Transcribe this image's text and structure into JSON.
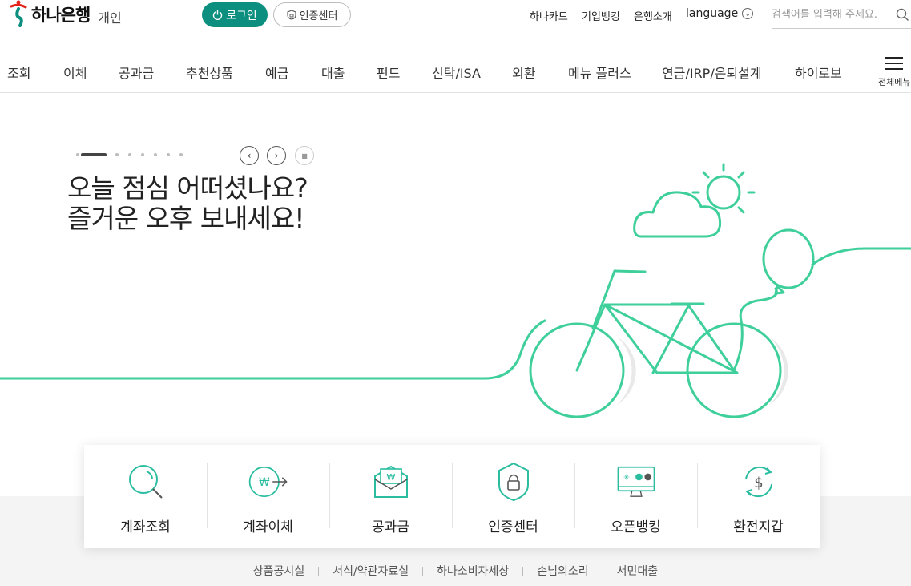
{
  "header": {
    "logo_text": "하나은행",
    "logo_sub": "개인",
    "login_label": "로그인",
    "cert_label": "인증센터",
    "links": [
      "하나카드",
      "기업뱅킹",
      "은행소개"
    ],
    "language_label": "language",
    "search_placeholder": "검색어를 입력해 주세요."
  },
  "nav": {
    "items": [
      "조회",
      "이체",
      "공과금",
      "추천상품",
      "예금",
      "대출",
      "펀드",
      "신탁/ISA",
      "외환",
      "메뉴 플러스",
      "연금/IRP/은퇴설계",
      "하이로보"
    ],
    "menu_all_label": "전체메뉴"
  },
  "hero": {
    "line1": "오늘 점심 어떠셨나요?",
    "line2": "즐거운 오후 보내세요!",
    "slide_count": 8,
    "active_slide": 1
  },
  "quick_menu": [
    {
      "label": "계좌조회",
      "icon": "search-icon"
    },
    {
      "label": "계좌이체",
      "icon": "won-transfer-icon"
    },
    {
      "label": "공과금",
      "icon": "envelope-won-icon"
    },
    {
      "label": "인증센터",
      "icon": "shield-lock-icon"
    },
    {
      "label": "오픈뱅킹",
      "icon": "monitor-icon"
    },
    {
      "label": "환전지갑",
      "icon": "dollar-exchange-icon"
    }
  ],
  "footer": {
    "links": [
      "상품공시실",
      "서식/약관자료실",
      "하나소비자세상",
      "손님의소리",
      "서민대출"
    ]
  },
  "colors": {
    "brand": "#0d8f80",
    "illustration": "#3ecf9a"
  }
}
